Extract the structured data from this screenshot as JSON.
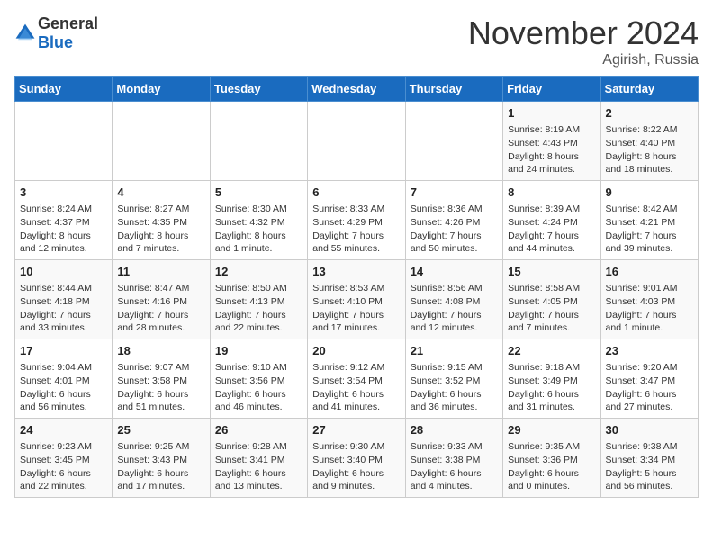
{
  "header": {
    "logo_general": "General",
    "logo_blue": "Blue",
    "month_title": "November 2024",
    "location": "Agirish, Russia"
  },
  "weekdays": [
    "Sunday",
    "Monday",
    "Tuesday",
    "Wednesday",
    "Thursday",
    "Friday",
    "Saturday"
  ],
  "weeks": [
    [
      {
        "day": "",
        "sunrise": "",
        "sunset": "",
        "daylight": ""
      },
      {
        "day": "",
        "sunrise": "",
        "sunset": "",
        "daylight": ""
      },
      {
        "day": "",
        "sunrise": "",
        "sunset": "",
        "daylight": ""
      },
      {
        "day": "",
        "sunrise": "",
        "sunset": "",
        "daylight": ""
      },
      {
        "day": "",
        "sunrise": "",
        "sunset": "",
        "daylight": ""
      },
      {
        "day": "1",
        "sunrise": "Sunrise: 8:19 AM",
        "sunset": "Sunset: 4:43 PM",
        "daylight": "Daylight: 8 hours and 24 minutes."
      },
      {
        "day": "2",
        "sunrise": "Sunrise: 8:22 AM",
        "sunset": "Sunset: 4:40 PM",
        "daylight": "Daylight: 8 hours and 18 minutes."
      }
    ],
    [
      {
        "day": "3",
        "sunrise": "Sunrise: 8:24 AM",
        "sunset": "Sunset: 4:37 PM",
        "daylight": "Daylight: 8 hours and 12 minutes."
      },
      {
        "day": "4",
        "sunrise": "Sunrise: 8:27 AM",
        "sunset": "Sunset: 4:35 PM",
        "daylight": "Daylight: 8 hours and 7 minutes."
      },
      {
        "day": "5",
        "sunrise": "Sunrise: 8:30 AM",
        "sunset": "Sunset: 4:32 PM",
        "daylight": "Daylight: 8 hours and 1 minute."
      },
      {
        "day": "6",
        "sunrise": "Sunrise: 8:33 AM",
        "sunset": "Sunset: 4:29 PM",
        "daylight": "Daylight: 7 hours and 55 minutes."
      },
      {
        "day": "7",
        "sunrise": "Sunrise: 8:36 AM",
        "sunset": "Sunset: 4:26 PM",
        "daylight": "Daylight: 7 hours and 50 minutes."
      },
      {
        "day": "8",
        "sunrise": "Sunrise: 8:39 AM",
        "sunset": "Sunset: 4:24 PM",
        "daylight": "Daylight: 7 hours and 44 minutes."
      },
      {
        "day": "9",
        "sunrise": "Sunrise: 8:42 AM",
        "sunset": "Sunset: 4:21 PM",
        "daylight": "Daylight: 7 hours and 39 minutes."
      }
    ],
    [
      {
        "day": "10",
        "sunrise": "Sunrise: 8:44 AM",
        "sunset": "Sunset: 4:18 PM",
        "daylight": "Daylight: 7 hours and 33 minutes."
      },
      {
        "day": "11",
        "sunrise": "Sunrise: 8:47 AM",
        "sunset": "Sunset: 4:16 PM",
        "daylight": "Daylight: 7 hours and 28 minutes."
      },
      {
        "day": "12",
        "sunrise": "Sunrise: 8:50 AM",
        "sunset": "Sunset: 4:13 PM",
        "daylight": "Daylight: 7 hours and 22 minutes."
      },
      {
        "day": "13",
        "sunrise": "Sunrise: 8:53 AM",
        "sunset": "Sunset: 4:10 PM",
        "daylight": "Daylight: 7 hours and 17 minutes."
      },
      {
        "day": "14",
        "sunrise": "Sunrise: 8:56 AM",
        "sunset": "Sunset: 4:08 PM",
        "daylight": "Daylight: 7 hours and 12 minutes."
      },
      {
        "day": "15",
        "sunrise": "Sunrise: 8:58 AM",
        "sunset": "Sunset: 4:05 PM",
        "daylight": "Daylight: 7 hours and 7 minutes."
      },
      {
        "day": "16",
        "sunrise": "Sunrise: 9:01 AM",
        "sunset": "Sunset: 4:03 PM",
        "daylight": "Daylight: 7 hours and 1 minute."
      }
    ],
    [
      {
        "day": "17",
        "sunrise": "Sunrise: 9:04 AM",
        "sunset": "Sunset: 4:01 PM",
        "daylight": "Daylight: 6 hours and 56 minutes."
      },
      {
        "day": "18",
        "sunrise": "Sunrise: 9:07 AM",
        "sunset": "Sunset: 3:58 PM",
        "daylight": "Daylight: 6 hours and 51 minutes."
      },
      {
        "day": "19",
        "sunrise": "Sunrise: 9:10 AM",
        "sunset": "Sunset: 3:56 PM",
        "daylight": "Daylight: 6 hours and 46 minutes."
      },
      {
        "day": "20",
        "sunrise": "Sunrise: 9:12 AM",
        "sunset": "Sunset: 3:54 PM",
        "daylight": "Daylight: 6 hours and 41 minutes."
      },
      {
        "day": "21",
        "sunrise": "Sunrise: 9:15 AM",
        "sunset": "Sunset: 3:52 PM",
        "daylight": "Daylight: 6 hours and 36 minutes."
      },
      {
        "day": "22",
        "sunrise": "Sunrise: 9:18 AM",
        "sunset": "Sunset: 3:49 PM",
        "daylight": "Daylight: 6 hours and 31 minutes."
      },
      {
        "day": "23",
        "sunrise": "Sunrise: 9:20 AM",
        "sunset": "Sunset: 3:47 PM",
        "daylight": "Daylight: 6 hours and 27 minutes."
      }
    ],
    [
      {
        "day": "24",
        "sunrise": "Sunrise: 9:23 AM",
        "sunset": "Sunset: 3:45 PM",
        "daylight": "Daylight: 6 hours and 22 minutes."
      },
      {
        "day": "25",
        "sunrise": "Sunrise: 9:25 AM",
        "sunset": "Sunset: 3:43 PM",
        "daylight": "Daylight: 6 hours and 17 minutes."
      },
      {
        "day": "26",
        "sunrise": "Sunrise: 9:28 AM",
        "sunset": "Sunset: 3:41 PM",
        "daylight": "Daylight: 6 hours and 13 minutes."
      },
      {
        "day": "27",
        "sunrise": "Sunrise: 9:30 AM",
        "sunset": "Sunset: 3:40 PM",
        "daylight": "Daylight: 6 hours and 9 minutes."
      },
      {
        "day": "28",
        "sunrise": "Sunrise: 9:33 AM",
        "sunset": "Sunset: 3:38 PM",
        "daylight": "Daylight: 6 hours and 4 minutes."
      },
      {
        "day": "29",
        "sunrise": "Sunrise: 9:35 AM",
        "sunset": "Sunset: 3:36 PM",
        "daylight": "Daylight: 6 hours and 0 minutes."
      },
      {
        "day": "30",
        "sunrise": "Sunrise: 9:38 AM",
        "sunset": "Sunset: 3:34 PM",
        "daylight": "Daylight: 5 hours and 56 minutes."
      }
    ]
  ]
}
